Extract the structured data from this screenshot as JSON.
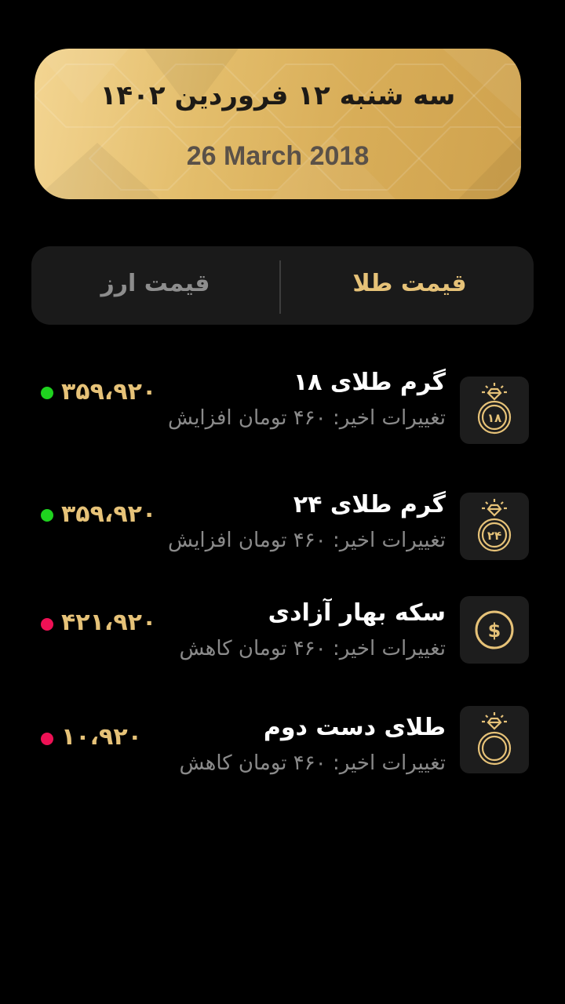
{
  "date_card": {
    "persian_date": "سه شنبه ۱۲ فروردین ۱۴۰۲",
    "gregorian_date": "26 March 2018"
  },
  "tabs": {
    "gold_label": "قیمت طلا",
    "currency_label": "قیمت ارز",
    "active": "gold"
  },
  "items": [
    {
      "title": "گرم طلای ۱۸",
      "subtitle": "تغییرات اخیر: ۴۶۰ تومان افزایش",
      "price": "۳۵۹،۹۲۰",
      "trend": "up",
      "icon": "ring-18-icon",
      "icon_label": "۱۸"
    },
    {
      "title": "گرم طلای ۲۴",
      "subtitle": "تغییرات اخیر: ۴۶۰ تومان افزایش",
      "price": "۳۵۹،۹۲۰",
      "trend": "up",
      "icon": "ring-24-icon",
      "icon_label": "۲۴"
    },
    {
      "title": "سکه بهار آزادی",
      "subtitle": "تغییرات اخیر: ۴۶۰ تومان کاهش",
      "price": "۴۲۱،۹۲۰",
      "trend": "down",
      "icon": "coin-dollar-icon"
    },
    {
      "title": "طلای دست دوم",
      "subtitle": "تغییرات اخیر: ۴۶۰ تومان کاهش",
      "price": "۱۰،۹۲۰",
      "trend": "down",
      "icon": "ring-icon"
    }
  ],
  "colors": {
    "accent_gold": "#e6c278",
    "up": "#1fd21f",
    "down": "#ee1155",
    "background": "#000000"
  }
}
